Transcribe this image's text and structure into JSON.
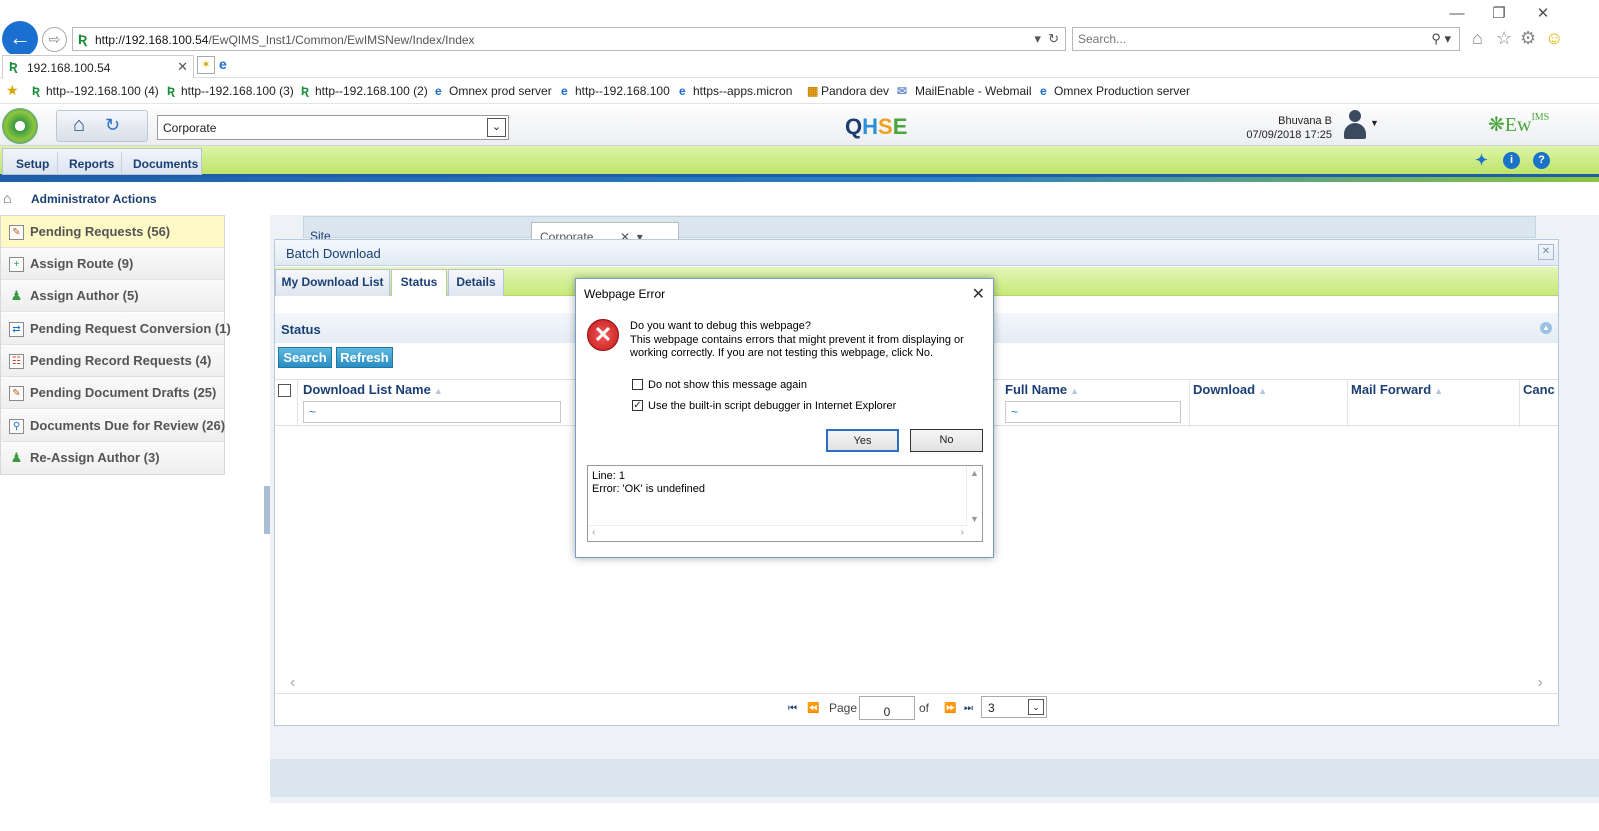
{
  "browser": {
    "address_host": "http://192.168.100.54",
    "address_path": "/EwQIMS_Inst1/Common/EwIMSNew/Index/Index",
    "search_placeholder": "Search...",
    "tab_title": "192.168.100.54",
    "favorites": [
      "http--192.168.100 (4)",
      "http--192.168.100 (3)",
      "http--192.168.100 (2)",
      "Omnex prod server",
      "http--192.168.100",
      "https--apps.micron",
      "Pandora dev",
      "MailEnable - Webmail",
      "Omnex Production server"
    ]
  },
  "header": {
    "site_select": "Corporate",
    "brand_q": "Q",
    "brand_h": "H",
    "brand_s": "S",
    "brand_e": "E",
    "user_name": "Bhuvana B",
    "datetime": "07/09/2018 17:25",
    "ew_logo": "Ew",
    "ew_logo_sup": "IMS"
  },
  "menu": {
    "setup": "Setup",
    "reports": "Reports",
    "documents": "Documents"
  },
  "breadcrumb": {
    "title": "Administrator Actions"
  },
  "sidebar": {
    "items": [
      {
        "label": "Pending Requests (56)",
        "icon": "pending-requests-icon"
      },
      {
        "label": "Assign Route (9)",
        "icon": "assign-route-icon"
      },
      {
        "label": "Assign Author (5)",
        "icon": "assign-author-icon"
      },
      {
        "label": "Pending Request Conversion (1)",
        "icon": "conversion-icon"
      },
      {
        "label": "Pending Record Requests (4)",
        "icon": "record-requests-icon"
      },
      {
        "label": "Pending Document Drafts (25)",
        "icon": "drafts-icon"
      },
      {
        "label": "Documents Due for Review (26)",
        "icon": "review-icon"
      },
      {
        "label": "Re-Assign Author (3)",
        "icon": "reassign-author-icon"
      }
    ]
  },
  "main": {
    "site_label": "Site",
    "site_value": "Corporate",
    "panel_title": "Batch Download",
    "tabs": [
      "My Download List",
      "Status",
      "Details"
    ],
    "section_title": "Status",
    "search_button": "Search",
    "refresh_button": "Refresh",
    "columns": [
      "Download List Name",
      "Full Name",
      "Download",
      "Mail Forward",
      "Canc"
    ],
    "filter_value": "~",
    "pager": {
      "page_label": "Page",
      "page_value": "0",
      "of_label": "of",
      "page_size": "3"
    }
  },
  "dialog": {
    "title": "Webpage Error",
    "question": "Do you want to debug this webpage?",
    "message": "This webpage contains errors that might prevent it from displaying or working correctly. If you are not testing this webpage, click No.",
    "check1_label": "Do not show this message again",
    "check2_label": "Use the built-in script debugger in Internet Explorer",
    "yes_label": "Yes",
    "no_label": "No",
    "details_line1": "Line: 1",
    "details_line2": "Error: 'OK' is undefined"
  }
}
